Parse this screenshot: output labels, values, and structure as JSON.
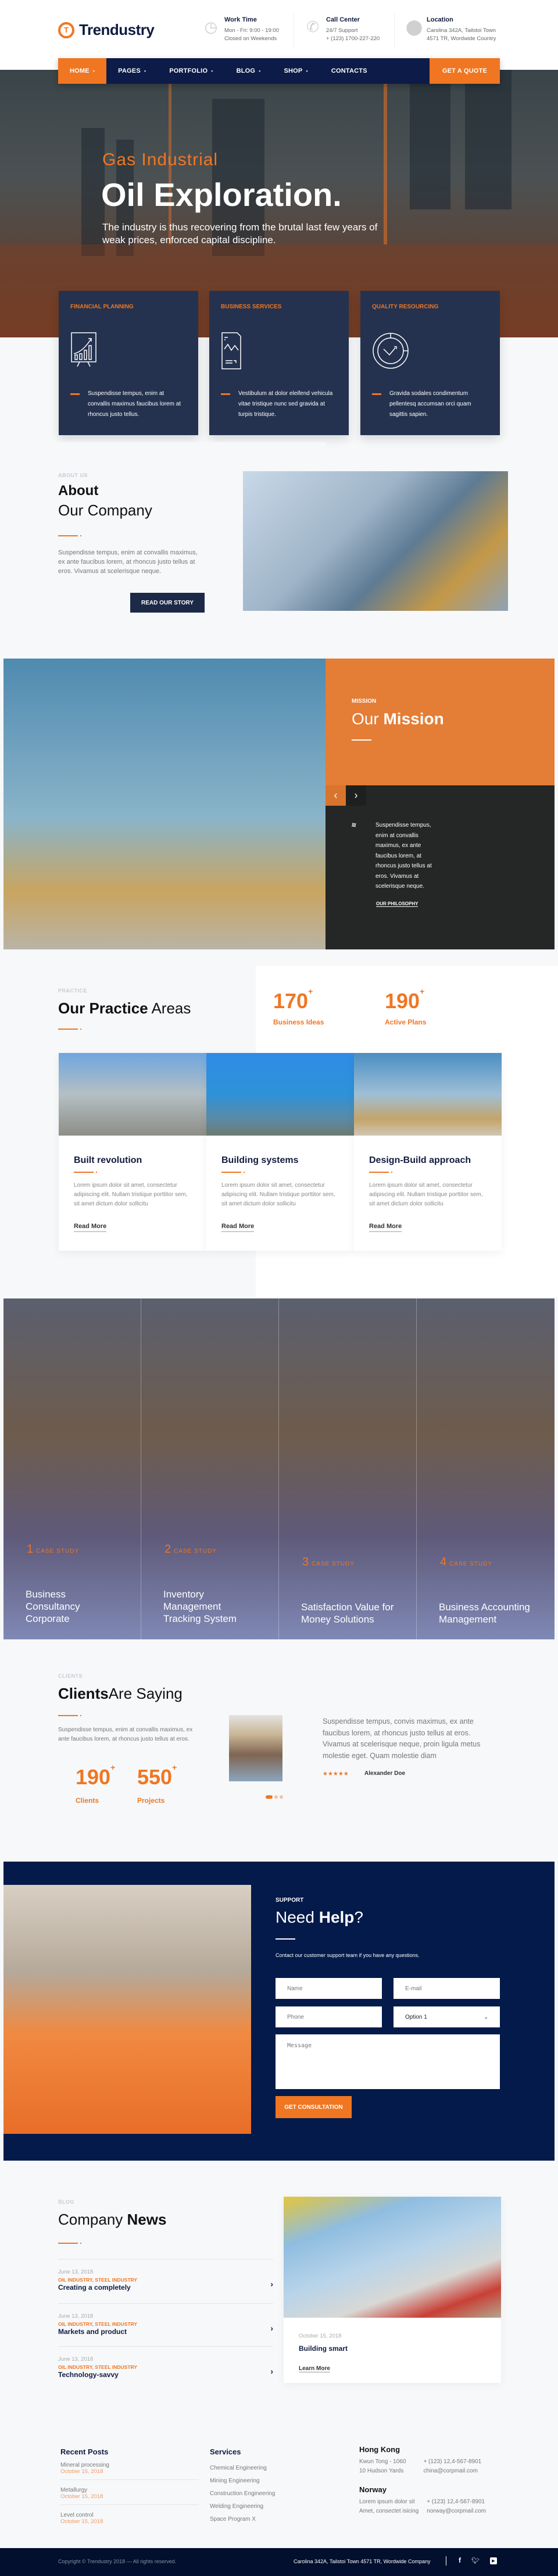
{
  "brand": {
    "name": "Trendustry",
    "logo_letter": "T"
  },
  "header_info": [
    {
      "icon": "clock-icon",
      "title": "Work Time",
      "lines": [
        "Mon - Fri: 9:00 - 19:00",
        "Closed on Weekends"
      ]
    },
    {
      "icon": "phone-icon",
      "title": "Call Center",
      "lines": [
        "24/7 Support",
        "+ (123) 1700-227-220"
      ]
    },
    {
      "icon": "location-pin-icon",
      "title": "Location",
      "lines": [
        "Carolina 342A, Tailstoi Town",
        "4571 TR, Wordwide Country"
      ]
    }
  ],
  "nav": {
    "items": [
      {
        "label": "HOME",
        "dropdown": true,
        "active": true
      },
      {
        "label": "PAGES",
        "dropdown": true
      },
      {
        "label": "PORTFOLIO",
        "dropdown": true
      },
      {
        "label": "BLOG",
        "dropdown": true
      },
      {
        "label": "SHOP",
        "dropdown": true
      },
      {
        "label": "CONTACTS",
        "dropdown": false
      }
    ],
    "dropdown_glyph": "•",
    "cta": "GET A QUOTE"
  },
  "hero": {
    "subtitle": "Gas Industrial",
    "title": "Oil Exploration.",
    "description": "The industry is thus recovering from the brutal last few years of weak prices, enforced capital discipline."
  },
  "features": [
    {
      "title": "FINANCIAL PLANNING",
      "icon": "growth-chart-board-icon",
      "text": "Suspendisse tempus, enim at convallis maximus faucibus lorem at rhoncus justo tellus."
    },
    {
      "title": "BUSINESS SERVICES",
      "icon": "report-document-icon",
      "text": "Vestibulum at dolor eleifend vehicula vitae tristique nunc sed gravida at turpis tristique."
    },
    {
      "title": "QUALITY RESOURCING",
      "icon": "cycle-arrow-icon",
      "text": "Gravida sodales condimentum pellentesq accumsan orci quam sagittis sapien."
    }
  ],
  "about": {
    "kicker": "ABOUT US",
    "title_bold": "About",
    "title_light": "Our Company",
    "text": "Suspendisse tempus, enim at convallis maximus, ex ante faucibus lorem, at rhoncus justo tellus at eros. Vivamus at scelerisque neque.",
    "button": "READ OUR STORY"
  },
  "mission": {
    "kicker": "MISSION",
    "title_light": "Our",
    "title_bold": "Mission",
    "prev": "‹",
    "next": "›",
    "text": "Suspendisse tempus, enim at convallis maximus, ex ante faucibus lorem, at rhoncus justo tellus at eros. Vivamus at scelerisque neque.",
    "link": "OUR PHILOSOPHY"
  },
  "practice": {
    "kicker": "PRACTICE",
    "title_bold": "Our Practice",
    "title_light": "Areas",
    "stats": [
      {
        "value": "170",
        "suffix": "+",
        "label": "Business Ideas"
      },
      {
        "value": "190",
        "suffix": "+",
        "label": "Active Plans"
      }
    ],
    "cards": [
      {
        "title": "Built revolution",
        "text": "Lorem ipsum dolor sit amet, consectetur adipiscing elit. Nullam tristique porttitor sem, sit amet dictum dolor sollicitu",
        "link": "Read More"
      },
      {
        "title": "Building systems",
        "text": "Lorem ipsum dolor sit amet, consectetur adipiscing elit. Nullam tristique porttitor sem, sit amet dictum dolor sollicitu",
        "link": "Read More"
      },
      {
        "title": "Design-Build approach",
        "text": "Lorem ipsum dolor sit amet, consectetur adipiscing elit. Nullam tristique porttitor sem, sit amet dictum dolor sollicitu",
        "link": "Read More"
      }
    ]
  },
  "cases": [
    {
      "num": "1",
      "label": "CASE STUDY",
      "title": "Business Consultancy Corporate"
    },
    {
      "num": "2",
      "label": "CASE STUDY",
      "title": "Inventory Management Tracking System"
    },
    {
      "num": "3",
      "label": "CASE STUDY",
      "title": "Satisfaction Value for Money Solutions"
    },
    {
      "num": "4",
      "label": "CASE STUDY",
      "title": "Business Accounting Management"
    }
  ],
  "clients": {
    "kicker": "CLIENTS",
    "title_bold": "Clients",
    "title_light": "Are Saying",
    "text": "Suspendisse tempus, enim at convallis maximus, ex ante faucibus lorem, at rhoncus justo tellus at eros.",
    "stats": [
      {
        "value": "190",
        "suffix": "+",
        "label": "Clients"
      },
      {
        "value": "550",
        "suffix": "+",
        "label": "Projects"
      }
    ],
    "testimonial": {
      "quote": "Suspendisse tempus, convis maximus, ex ante faucibus lorem, at rhoncus justo tellus at eros. Vivamus at scelerisque neque, proin ligula metus molestie eget. Quam molestie diam",
      "stars": "★★★★★",
      "rating": 5,
      "author": "Alexander Doe"
    },
    "slider_dots": 3,
    "active_dot": 1
  },
  "support": {
    "kicker": "SUPPORT",
    "title_light": "Need",
    "title_bold": "Help",
    "title_end": "?",
    "text": "Contact our customer support team if you have any questions.",
    "fields": {
      "name_placeholder": "Name",
      "email_placeholder": "E-mail",
      "phone_placeholder": "Phone",
      "select_value": "Option 1",
      "message_placeholder": "Message"
    },
    "button": "GET CONSULTATION"
  },
  "news": {
    "kicker": "BLOG",
    "title_light": "Company",
    "title_bold": "News",
    "items": [
      {
        "date": "June 13, 2018",
        "categories": "OIL INDUSTRY, STEEL INDUSTRY",
        "title": "Creating a completely"
      },
      {
        "date": "June 13, 2018",
        "categories": "OIL INDUSTRY, STEEL INDUSTRY",
        "title": "Markets and product"
      },
      {
        "date": "June 13, 2018",
        "categories": "OIL INDUSTRY, STEEL INDUSTRY",
        "title": "Technology-savvy"
      }
    ],
    "featured": {
      "date": "October 15, 2018",
      "title": "Building smart",
      "link": "Learn More"
    }
  },
  "footer": {
    "recent_title": "Recent Posts",
    "recent": [
      {
        "title": "Mineral processing",
        "date": "October 15, 2018"
      },
      {
        "title": "Metallurgy",
        "date": "October 15, 2018"
      },
      {
        "title": "Level control",
        "date": "October 15, 2018"
      }
    ],
    "services_title": "Services",
    "services": [
      "Chemical Engineering",
      "Mining Engineering",
      "Construction Engineering",
      "Welding Engineering",
      "Space Program X"
    ],
    "offices": [
      {
        "name": "Hong Kong",
        "address": [
          "Kwun Tong - 1060",
          "10 Hudson Yards"
        ],
        "contact": [
          "+ (123) 12,4-567-8901",
          "china@corpmail.com"
        ]
      },
      {
        "name": "Norway",
        "address": [
          "Lorem ipsum dolor sit",
          "Amet, consectet isicing"
        ],
        "contact": [
          "+ (123) 12,4-567-8901",
          "norway@corpmail.com"
        ]
      }
    ],
    "copyright": "Copyright © Trendustry 2018 — All rights reserved.",
    "address": "Carolina 342A, Tailstoi Town 4571 TR, Wordwide Company",
    "social": [
      "facebook-icon",
      "twitter-icon",
      "youtube-icon"
    ]
  },
  "colors": {
    "accent": "#f07622",
    "navy": "#0c1b47",
    "card": "#24324f",
    "support_bg": "#031a4a",
    "footer_bg": "#020f2e"
  }
}
